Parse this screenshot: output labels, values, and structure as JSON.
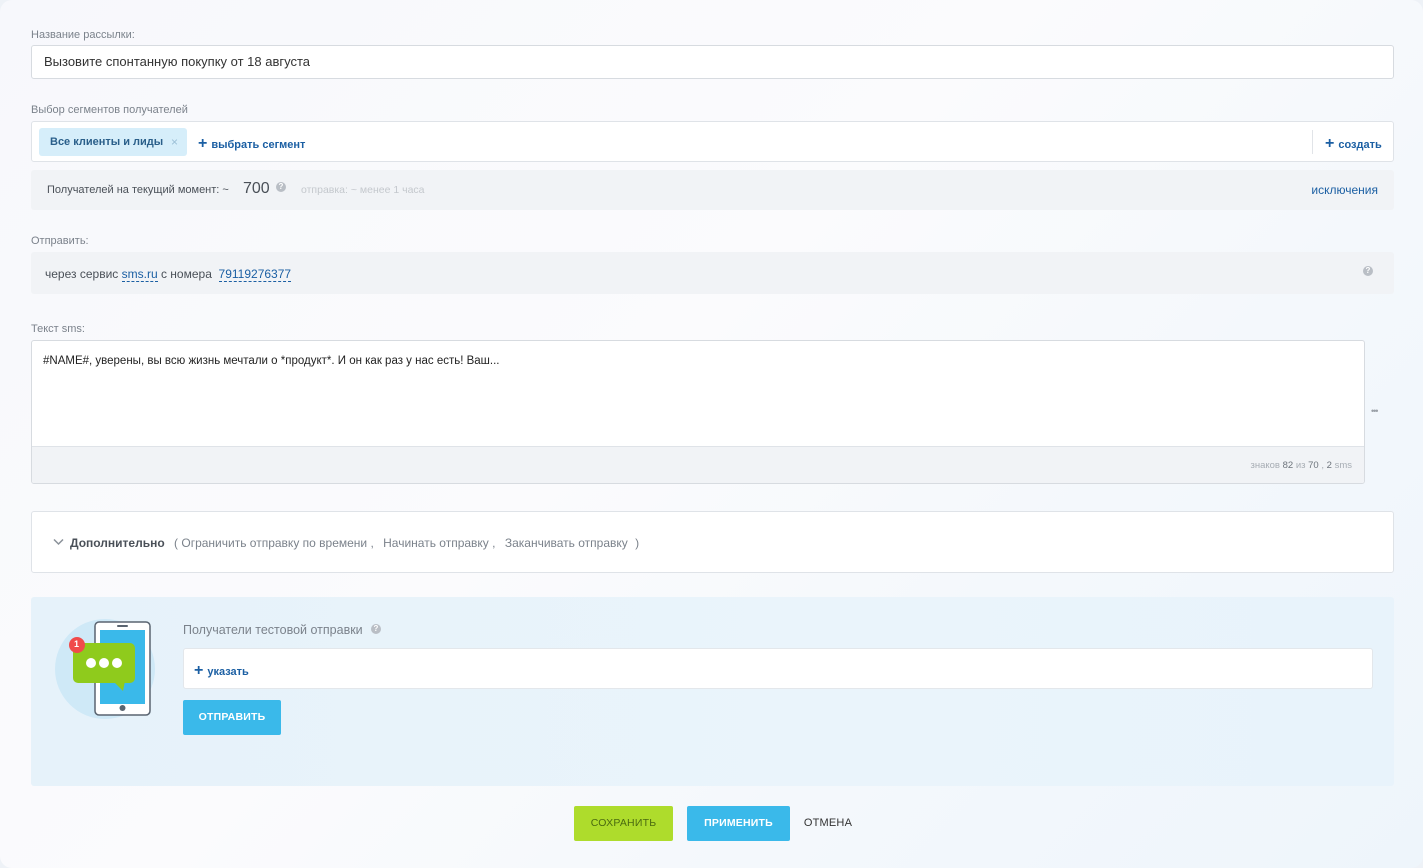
{
  "name_field": {
    "label": "Название рассылки:",
    "value": "Вызовите спонтанную покупку от 18 августа"
  },
  "segments": {
    "label": "Выбор сегментов получателей",
    "chip_label": "Все клиенты и лиды",
    "chip_remove": "×",
    "choose_link": "выбрать сегмент",
    "create_link": "создать",
    "plus": "+"
  },
  "recipients": {
    "label": "Получателей на текущий момент: ~",
    "count": "700",
    "send_time": "отправка: ~ менее 1 часа",
    "exclusions_link": "исключения",
    "help": "?"
  },
  "send_via": {
    "label": "Отправить:",
    "prefix": "через сервис",
    "service": "sms.ru",
    "middle": "с номера",
    "phone": "79119276377",
    "help": "?"
  },
  "sms": {
    "label": "Текст sms:",
    "text": "#NAME#, уверены, вы всю жизнь мечтали о *продукт*. И он как раз у нас есть! Ваш...",
    "counter_prefix": "знаков",
    "chars": "82",
    "counter_of": "из",
    "limit": "70",
    "counter_sep": ",",
    "sms_count": "2",
    "sms_unit": "sms",
    "more": "•••"
  },
  "advanced": {
    "title": "Дополнительно",
    "open_paren": "(",
    "items": [
      "Ограничить отправку по времени ,",
      "Начинать отправку ,",
      "Заканчивать отправку"
    ],
    "close_paren": ")"
  },
  "test_send": {
    "label": "Получатели тестовой отправки",
    "help": "?",
    "add_link": "указать",
    "plus": "+",
    "send_button": "ОТПРАВИТЬ",
    "badge": "1"
  },
  "footer": {
    "save": "СОХРАНИТЬ",
    "apply": "ПРИМЕНИТЬ",
    "cancel": "ОТМЕНА"
  },
  "colors": {
    "green": "#aedc2c",
    "blue": "#3ab9ea",
    "link": "#1b5fa3"
  }
}
